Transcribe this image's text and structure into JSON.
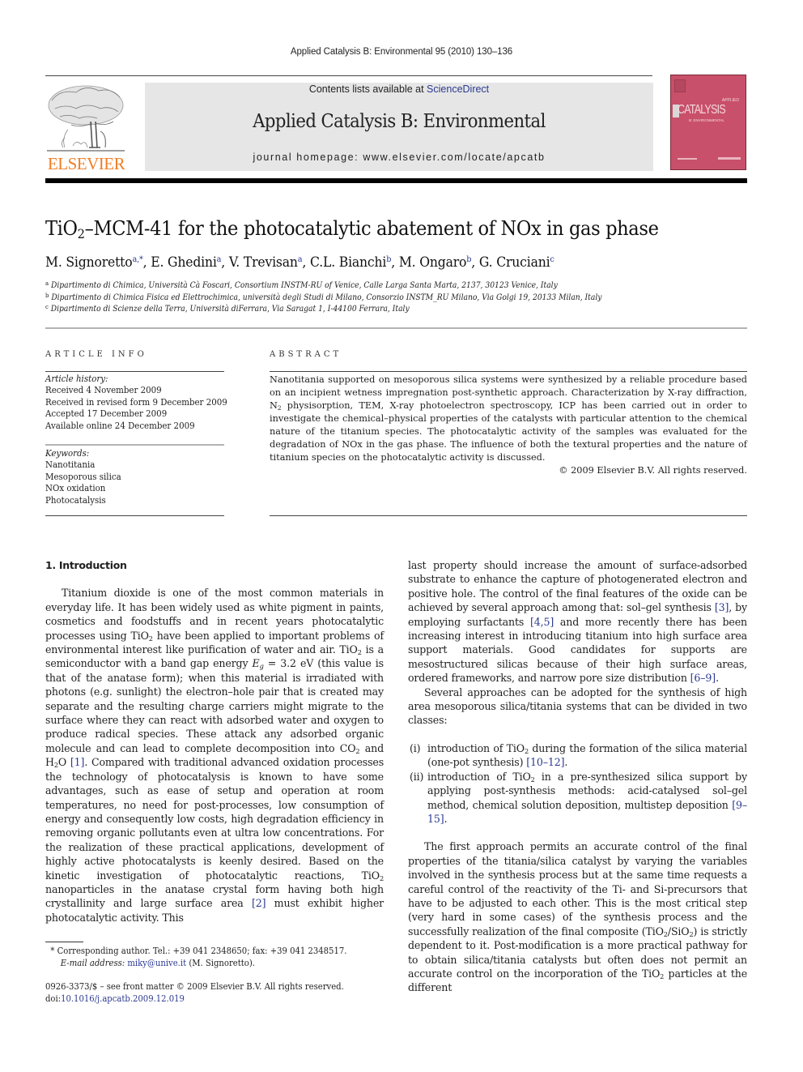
{
  "running_head": "Applied Catalysis B: Environmental 95 (2010) 130–136",
  "masthead": {
    "publisher_logo": "ELSEVIER",
    "contents_prefix": "Contents lists available at ",
    "contents_link": "ScienceDirect",
    "journal_title": "Applied Catalysis B: Environmental",
    "homepage_label": "journal homepage: ",
    "homepage_url": "www.elsevier.com/locate/apcatb",
    "cover": {
      "title": "CATALYSIS",
      "applied": "APPLIED",
      "subtitle": "B: ENVIRONMENTAL",
      "color": "#c9506a"
    }
  },
  "article": {
    "title_pre": "TiO",
    "title_sub": "2",
    "title_post": "–MCM-41 for the photocatalytic abatement of NOx in gas phase",
    "authors": [
      {
        "name": "M. Signoretto",
        "sup": "a,*",
        "sep": ", "
      },
      {
        "name": "E. Ghedini",
        "sup": "a",
        "sep": ", "
      },
      {
        "name": "V. Trevisan",
        "sup": "a",
        "sep": ", "
      },
      {
        "name": "C.L. Bianchi",
        "sup": "b",
        "sep": ", "
      },
      {
        "name": "M. Ongaro",
        "sup": "b",
        "sep": ", "
      },
      {
        "name": "G. Cruciani",
        "sup": "c",
        "sep": ""
      }
    ],
    "affiliations": [
      {
        "key": "a",
        "text": "Dipartimento di Chimica, Università Cà Foscari, Consortium INSTM-RU of Venice, Calle Larga Santa Marta, 2137, 30123 Venice, Italy"
      },
      {
        "key": "b",
        "text": "Dipartimento di Chimica Fisica ed Elettrochimica, università degli Studi di Milano, Consorzio INSTM_RU Milano, Via Golgi 19, 20133 Milan, Italy"
      },
      {
        "key": "c",
        "text": "Dipartimento di Scienze della Terra, Università diFerrara, Via Saragat 1, I-44100 Ferrara, Italy"
      }
    ]
  },
  "article_info": {
    "label": "ARTICLE INFO",
    "history_label": "Article history:",
    "history": [
      "Received 4 November 2009",
      "Received in revised form 9 December 2009",
      "Accepted 17 December 2009",
      "Available online 24 December 2009"
    ],
    "keywords_label": "Keywords:",
    "keywords": [
      "Nanotitania",
      "Mesoporous silica",
      "NOx oxidation",
      "Photocatalysis"
    ]
  },
  "abstract": {
    "label": "ABSTRACT",
    "text_1": "Nanotitania supported on mesoporous silica systems were synthesized by a reliable procedure based on an incipient wetness impregnation post-synthetic approach. Characterization by X-ray diffraction, N",
    "text_sub": "2",
    "text_2": " physisorption, TEM, X-ray photoelectron spectroscopy, ICP has been carried out in order to investigate the chemical–physical properties of the catalysts with particular attention to the chemical nature of the titanium species. The photocatalytic activity of the samples was evaluated for the degradation of NOx in the gas phase. The influence of both the textural properties and the nature of titanium species on the photocatalytic activity is discussed.",
    "copyright": "© 2009 Elsevier B.V. All rights reserved."
  },
  "body": {
    "section_heading": "1.  Introduction",
    "p1": {
      "s1": "Titanium dioxide is one of the most common materials in everyday life. It has been widely used as white pigment in paints, cosmetics and foodstuffs and in recent years photocatalytic processes using TiO",
      "s2": " have been applied to important problems of environmental interest like purification of water and air. TiO",
      "s3": " is a semiconductor with a band gap energy ",
      "eg": "E",
      "eg_sub": "g",
      "s4": " = 3.2 eV (this value is that of the anatase form); when this material is irradiated with photons (e.g. sunlight) the electron–hole pair that is created may separate and the resulting charge carriers might migrate to the surface where they can react with adsorbed water and oxygen to produce radical species. These attack any adsorbed organic molecule and can lead to complete decomposition into CO",
      "s5": " and H",
      "s6": "O ",
      "ref1": "[1]",
      "s7": ". Compared with traditional advanced oxidation processes the technology of photocatalysis is known to have some advantages, such as ease of setup and operation at room temperatures, no need for post-processes, low consumption of energy and consequently low costs, high degradation efficiency in removing organic pollutants even at ultra low concentrations. For the realization of these practical applications, development of highly active photocatalysts is keenly desired. Based on the kinetic investigation of photocatalytic reactions, TiO",
      "s8": " nanoparticles in the anatase crystal form having both high crystallinity and large surface area ",
      "ref2": "[2]",
      "s9": " must exhibit higher photocatalytic activity. This last property should increase the amount of surface-adsorbed substrate to enhance the capture of photogenerated electron and positive hole. The control of the final features of the oxide can be achieved by several approach among that: sol–gel synthesis ",
      "ref3": "[3]",
      "s10": ", by employing surfactants ",
      "ref4": "[4,5]",
      "s11": " and more recently there has been increasing interest in introducing titanium into high surface area support materials. Good candidates for supports are mesostructured silicas because of their high surface areas, ordered frameworks, and narrow pore size distribution ",
      "ref5": "[6–9]",
      "s12": "."
    },
    "p2": "Several approaches can be adopted for the synthesis of high area mesoporous silica/titania systems that can be divided in two classes:",
    "list": [
      {
        "num": "(i)",
        "a": "introduction of TiO",
        "b": " during the formation of the silica material (one-pot synthesis) ",
        "ref": "[10–12]",
        "c": "."
      },
      {
        "num": "(ii)",
        "a": "introduction of TiO",
        "b": " in a pre-synthesized silica support by applying post-synthesis methods: acid-catalysed sol–gel method, chemical solution deposition, multistep deposition ",
        "ref": "[9–15]",
        "c": "."
      }
    ],
    "p3": {
      "s1": "The first approach permits an accurate control of the final properties of the titania/silica catalyst by varying the variables involved in the synthesis process but at the same time requests a careful control of the reactivity of the Ti- and Si-precursors that have to be adjusted to each other. This is the most critical step (very hard in some cases) of the synthesis process and the successfully realization of the final composite (TiO",
      "s2": "/SiO",
      "s3": ") is strictly dependent to it. Post-modification is a more practical pathway for to obtain silica/titania catalysts but often does not permit an accurate control on the incorporation of the TiO",
      "s4": " particles at the different"
    },
    "sub2": "2"
  },
  "footnote": {
    "star": "*",
    "corresponding": " Corresponding author. Tel.: +39 041 2348650; fax: +39 041 2348517.",
    "email_label": "E-mail address: ",
    "email": "miky@unive.it",
    "email_owner": " (M. Signoretto)."
  },
  "front_matter": {
    "issn_line": "0926-3373/$ – see front matter © 2009 Elsevier B.V. All rights reserved.",
    "doi_label": "doi:",
    "doi": "10.1016/j.apcatb.2009.12.019"
  }
}
